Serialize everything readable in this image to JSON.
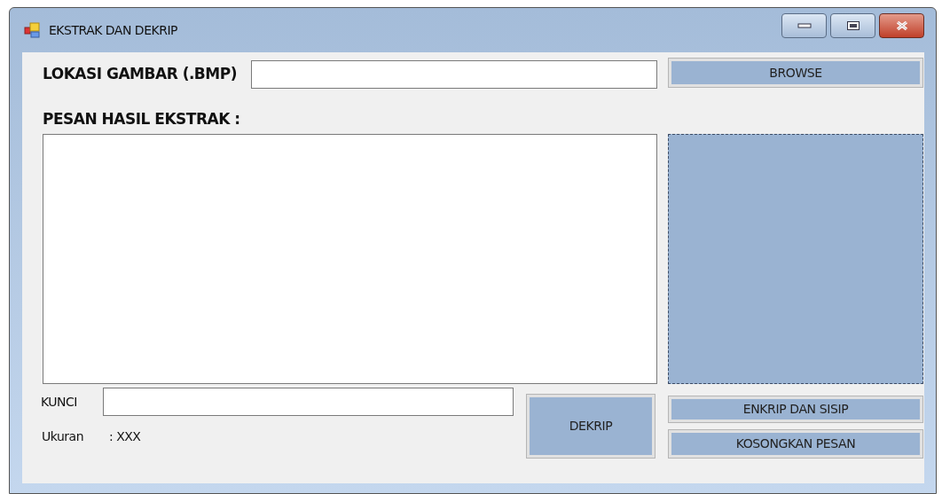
{
  "window": {
    "title": "EKSTRAK DAN DEKRIP"
  },
  "image_path": {
    "label": "LOKASI GAMBAR (.BMP)",
    "browse_button": "BROWSE"
  },
  "message": {
    "label": "PESAN HASIL EKSTRAK :"
  },
  "key": {
    "label": "KUNCI"
  },
  "size": {
    "label": "Ukuran",
    "value": ": XXX"
  },
  "buttons": [
    {
      "kind": "decrypt",
      "label": "DEKRIP"
    },
    {
      "kind": "encrypt",
      "label": "ENKRIP DAN SISIP"
    },
    {
      "kind": "clear",
      "label": "KOSONGKAN PESAN"
    }
  ]
}
